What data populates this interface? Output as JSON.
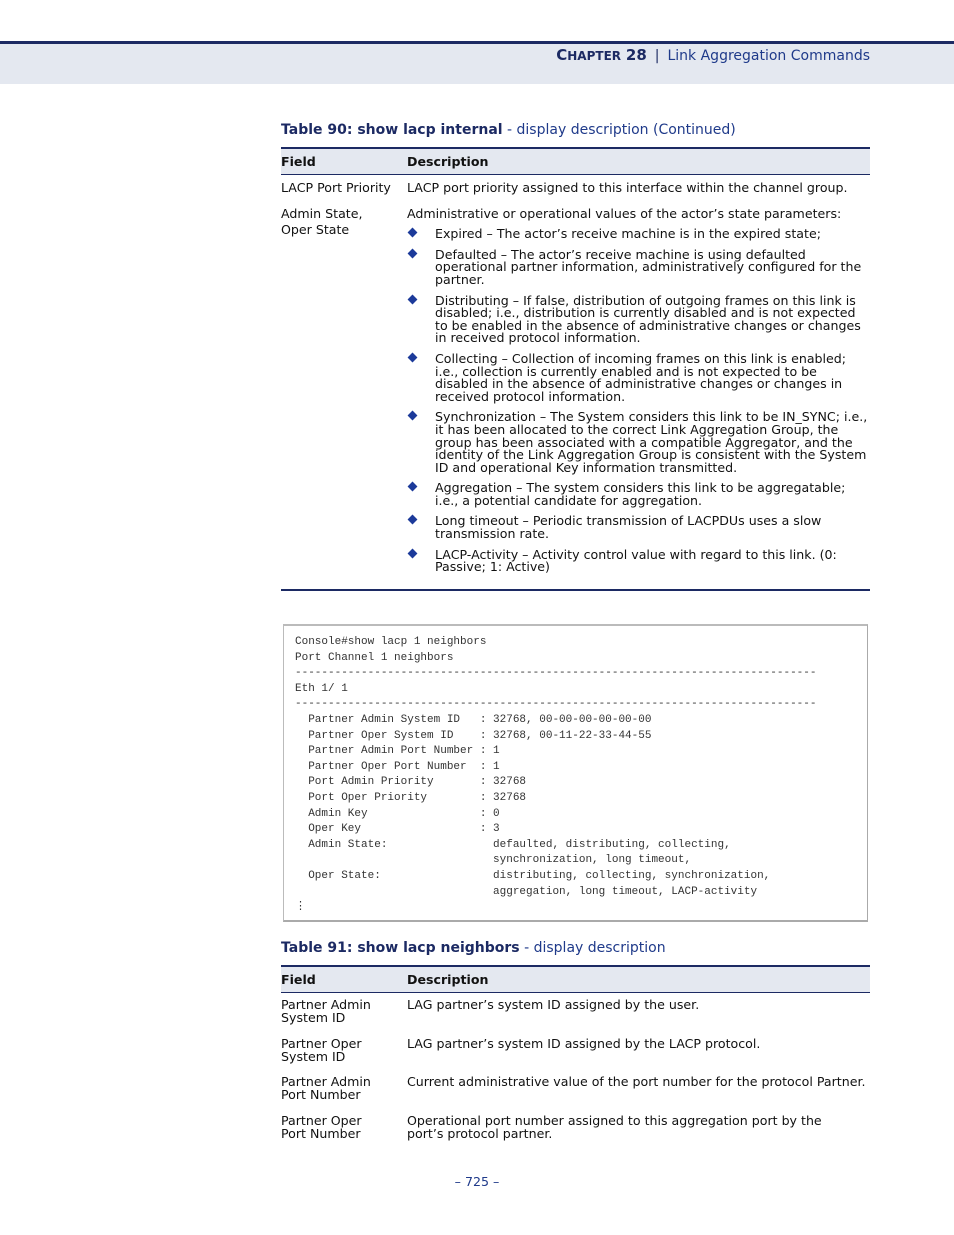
{
  "header": {
    "chapter_label": "Chapter",
    "chapter_number": "28",
    "separator": "|",
    "chapter_title": "Link Aggregation Commands"
  },
  "table90": {
    "title_bold": "Table 90: show lacp internal",
    "title_rest": " - display description (Continued)",
    "col_field": "Field",
    "col_desc": "Description",
    "rows": [
      {
        "field": "LACP Port Priority",
        "desc": "LACP port priority assigned to this interface within the channel group."
      },
      {
        "field": "Admin State, Oper State",
        "desc": "Administrative or operational values of the actor’s state parameters:",
        "bullets": [
          "Expired – The actor’s receive machine is in the expired state;",
          "Defaulted – The actor’s receive machine is using defaulted operational partner information, administratively configured for the partner.",
          "Distributing – If false, distribution of outgoing frames on this link is disabled; i.e., distribution is currently disabled and is not expected to be enabled in the absence of administrative changes or changes in received protocol information.",
          "Collecting – Collection of incoming frames on this link is enabled; i.e., collection is currently enabled and is not expected to be disabled in the absence of administrative changes or changes in received protocol information.",
          "Synchronization – The System considers this link to be IN_SYNC; i.e., it has been allocated to the correct Link Aggregation Group, the group has been associated with a compatible Aggregator, and the identity of the Link Aggregation Group is consistent with the System ID and operational Key information transmitted.",
          "Aggregation – The system considers this link to be aggregatable; i.e., a potential candidate for aggregation.",
          "Long timeout – Periodic transmission of LACPDUs uses a slow transmission rate.",
          "LACP-Activity – Activity control value with regard to this link. (0: Passive; 1: Active)"
        ]
      }
    ]
  },
  "console": {
    "text": "Console#show lacp 1 neighbors\nPort Channel 1 neighbors\n-------------------------------------------------------------------------------\nEth 1/ 1\n-------------------------------------------------------------------------------\n  Partner Admin System ID   : 32768, 00-00-00-00-00-00\n  Partner Oper System ID    : 32768, 00-11-22-33-44-55\n  Partner Admin Port Number : 1\n  Partner Oper Port Number  : 1\n  Port Admin Priority       : 32768\n  Port Oper Priority        : 32768\n  Admin Key                 : 0\n  Oper Key                  : 3\n  Admin State:                defaulted, distributing, collecting,\n                              synchronization, long timeout,\n  Oper State:                 distributing, collecting, synchronization,\n                              aggregation, long timeout, LACP-activity\n⋮"
  },
  "table91": {
    "title_bold": "Table 91: show lacp neighbors",
    "title_rest": " - display description",
    "col_field": "Field",
    "col_desc": "Description",
    "rows": [
      {
        "field": "Partner Admin System ID",
        "desc": "LAG partner’s system ID assigned by the user."
      },
      {
        "field": "Partner Oper System ID",
        "desc": "LAG partner’s system ID assigned by the LACP protocol."
      },
      {
        "field": "Partner Admin Port Number",
        "desc": "Current administrative value of the port number for the protocol Partner."
      },
      {
        "field": "Partner Oper Port Number",
        "desc": "Operational port number assigned to this aggregation port by the port’s protocol partner."
      }
    ]
  },
  "footer": {
    "page": "–  725  –"
  }
}
